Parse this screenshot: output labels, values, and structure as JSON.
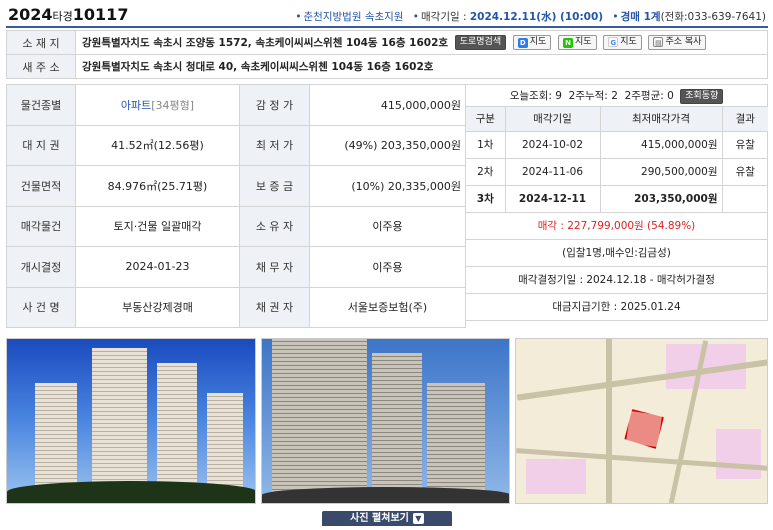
{
  "header": {
    "case_year": "2024",
    "case_type": "타경",
    "case_number": "10117",
    "court": "춘천지방법원 속초지원",
    "sale_date_label": "매각기일 : ",
    "sale_date": "2024.12.11(水) (10:00)",
    "dept": "경매 1계",
    "phone": "(전화:033-639-7641)"
  },
  "address": {
    "location_label": "소 재 지",
    "location": "강원특별자치도 속초시 조양동 1572, 속초케이씨씨스위첸 104동 16층 1602호",
    "new_address_label": "새 주 소",
    "new_address": "강원특별자치도 속초시 청대로 40, 속초케이씨씨스위첸 104동 16층 1602호",
    "buttons": {
      "road_search": "도로명검색",
      "daum_map": "지도",
      "naver_map": "지도",
      "google_map": "지도",
      "copy_address": "주소 복사"
    }
  },
  "details": {
    "type_label": "물건종별",
    "type": "아파트",
    "type_size": "[34평형]",
    "appraisal_label": "감 정 가",
    "appraisal": "415,000,000원",
    "land_label": "대 지 권",
    "land": "41.52㎡(12.56평)",
    "min_price_label": "최 저 가",
    "min_price": "(49%) 203,350,000원",
    "building_label": "건물면적",
    "building": "84.976㎡(25.71평)",
    "deposit_label": "보 증 금",
    "deposit": "(10%) 20,335,000원",
    "sale_item_label": "매각물건",
    "sale_item": "토지·건물 일괄매각",
    "owner_label": "소 유 자",
    "owner": "이주용",
    "start_label": "개시결정",
    "start": "2024-01-23",
    "debtor_label": "채 무 자",
    "debtor": "이주용",
    "case_name_label": "사 건 명",
    "case_name": "부동산강제경매",
    "creditor_label": "채 권 자",
    "creditor": "서울보증보험(주)"
  },
  "stats": {
    "today_label": "오늘조회:",
    "today": "9",
    "two_week_label": "2주누적:",
    "two_week": "2",
    "avg_label": "2주평균:",
    "avg": "0",
    "trend_button": "조회동향"
  },
  "history": {
    "headers": [
      "구분",
      "매각기일",
      "최저매각가격",
      "결과"
    ],
    "rows": [
      {
        "round": "1차",
        "date": "2024-10-02",
        "price": "415,000,000원",
        "result": "유찰"
      },
      {
        "round": "2차",
        "date": "2024-11-06",
        "price": "290,500,000원",
        "result": "유찰"
      },
      {
        "round": "3차",
        "date": "2024-12-11",
        "price": "203,350,000원",
        "result": ""
      }
    ]
  },
  "result": {
    "sold": "매각 : 227,799,000원 (54.89%)",
    "bidders": "(입찰1명,매수인:김금성)",
    "decision": "매각결정기일 : 2024.12.18 - 매각허가결정",
    "payment": "대금지급기한 : 2025.01.24"
  },
  "photo_bar": {
    "label": "사진 펼쳐보기"
  },
  "colors": {
    "accent": "#2255aa",
    "sold_red": "#dd2222",
    "header_line": "#3a5aa0"
  }
}
